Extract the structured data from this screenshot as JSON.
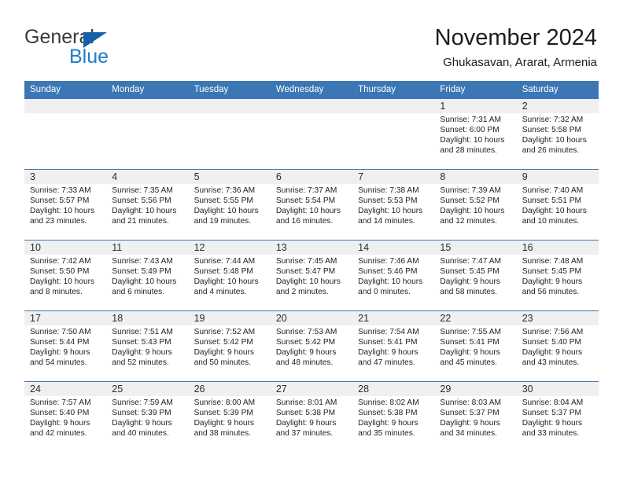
{
  "brand": {
    "name_part1": "General",
    "name_part2": "Blue",
    "triangle_icon": "triangle-icon",
    "accent_blue": "#1b7ec9",
    "logo_dark": "#3b3b3b"
  },
  "header": {
    "title": "November 2024",
    "subtitle": "Ghukasavan, Ararat, Armenia",
    "header_bg": "#3c77b5",
    "daynum_bg": "#f0f0f0"
  },
  "weekdays": [
    "Sunday",
    "Monday",
    "Tuesday",
    "Wednesday",
    "Thursday",
    "Friday",
    "Saturday"
  ],
  "weeks": [
    [
      {
        "day": "",
        "sunrise": "",
        "sunset": "",
        "daylight_line1": "",
        "daylight_line2": ""
      },
      {
        "day": "",
        "sunrise": "",
        "sunset": "",
        "daylight_line1": "",
        "daylight_line2": ""
      },
      {
        "day": "",
        "sunrise": "",
        "sunset": "",
        "daylight_line1": "",
        "daylight_line2": ""
      },
      {
        "day": "",
        "sunrise": "",
        "sunset": "",
        "daylight_line1": "",
        "daylight_line2": ""
      },
      {
        "day": "",
        "sunrise": "",
        "sunset": "",
        "daylight_line1": "",
        "daylight_line2": ""
      },
      {
        "day": "1",
        "sunrise": "Sunrise: 7:31 AM",
        "sunset": "Sunset: 6:00 PM",
        "daylight_line1": "Daylight: 10 hours",
        "daylight_line2": "and 28 minutes."
      },
      {
        "day": "2",
        "sunrise": "Sunrise: 7:32 AM",
        "sunset": "Sunset: 5:58 PM",
        "daylight_line1": "Daylight: 10 hours",
        "daylight_line2": "and 26 minutes."
      }
    ],
    [
      {
        "day": "3",
        "sunrise": "Sunrise: 7:33 AM",
        "sunset": "Sunset: 5:57 PM",
        "daylight_line1": "Daylight: 10 hours",
        "daylight_line2": "and 23 minutes."
      },
      {
        "day": "4",
        "sunrise": "Sunrise: 7:35 AM",
        "sunset": "Sunset: 5:56 PM",
        "daylight_line1": "Daylight: 10 hours",
        "daylight_line2": "and 21 minutes."
      },
      {
        "day": "5",
        "sunrise": "Sunrise: 7:36 AM",
        "sunset": "Sunset: 5:55 PM",
        "daylight_line1": "Daylight: 10 hours",
        "daylight_line2": "and 19 minutes."
      },
      {
        "day": "6",
        "sunrise": "Sunrise: 7:37 AM",
        "sunset": "Sunset: 5:54 PM",
        "daylight_line1": "Daylight: 10 hours",
        "daylight_line2": "and 16 minutes."
      },
      {
        "day": "7",
        "sunrise": "Sunrise: 7:38 AM",
        "sunset": "Sunset: 5:53 PM",
        "daylight_line1": "Daylight: 10 hours",
        "daylight_line2": "and 14 minutes."
      },
      {
        "day": "8",
        "sunrise": "Sunrise: 7:39 AM",
        "sunset": "Sunset: 5:52 PM",
        "daylight_line1": "Daylight: 10 hours",
        "daylight_line2": "and 12 minutes."
      },
      {
        "day": "9",
        "sunrise": "Sunrise: 7:40 AM",
        "sunset": "Sunset: 5:51 PM",
        "daylight_line1": "Daylight: 10 hours",
        "daylight_line2": "and 10 minutes."
      }
    ],
    [
      {
        "day": "10",
        "sunrise": "Sunrise: 7:42 AM",
        "sunset": "Sunset: 5:50 PM",
        "daylight_line1": "Daylight: 10 hours",
        "daylight_line2": "and 8 minutes."
      },
      {
        "day": "11",
        "sunrise": "Sunrise: 7:43 AM",
        "sunset": "Sunset: 5:49 PM",
        "daylight_line1": "Daylight: 10 hours",
        "daylight_line2": "and 6 minutes."
      },
      {
        "day": "12",
        "sunrise": "Sunrise: 7:44 AM",
        "sunset": "Sunset: 5:48 PM",
        "daylight_line1": "Daylight: 10 hours",
        "daylight_line2": "and 4 minutes."
      },
      {
        "day": "13",
        "sunrise": "Sunrise: 7:45 AM",
        "sunset": "Sunset: 5:47 PM",
        "daylight_line1": "Daylight: 10 hours",
        "daylight_line2": "and 2 minutes."
      },
      {
        "day": "14",
        "sunrise": "Sunrise: 7:46 AM",
        "sunset": "Sunset: 5:46 PM",
        "daylight_line1": "Daylight: 10 hours",
        "daylight_line2": "and 0 minutes."
      },
      {
        "day": "15",
        "sunrise": "Sunrise: 7:47 AM",
        "sunset": "Sunset: 5:45 PM",
        "daylight_line1": "Daylight: 9 hours",
        "daylight_line2": "and 58 minutes."
      },
      {
        "day": "16",
        "sunrise": "Sunrise: 7:48 AM",
        "sunset": "Sunset: 5:45 PM",
        "daylight_line1": "Daylight: 9 hours",
        "daylight_line2": "and 56 minutes."
      }
    ],
    [
      {
        "day": "17",
        "sunrise": "Sunrise: 7:50 AM",
        "sunset": "Sunset: 5:44 PM",
        "daylight_line1": "Daylight: 9 hours",
        "daylight_line2": "and 54 minutes."
      },
      {
        "day": "18",
        "sunrise": "Sunrise: 7:51 AM",
        "sunset": "Sunset: 5:43 PM",
        "daylight_line1": "Daylight: 9 hours",
        "daylight_line2": "and 52 minutes."
      },
      {
        "day": "19",
        "sunrise": "Sunrise: 7:52 AM",
        "sunset": "Sunset: 5:42 PM",
        "daylight_line1": "Daylight: 9 hours",
        "daylight_line2": "and 50 minutes."
      },
      {
        "day": "20",
        "sunrise": "Sunrise: 7:53 AM",
        "sunset": "Sunset: 5:42 PM",
        "daylight_line1": "Daylight: 9 hours",
        "daylight_line2": "and 48 minutes."
      },
      {
        "day": "21",
        "sunrise": "Sunrise: 7:54 AM",
        "sunset": "Sunset: 5:41 PM",
        "daylight_line1": "Daylight: 9 hours",
        "daylight_line2": "and 47 minutes."
      },
      {
        "day": "22",
        "sunrise": "Sunrise: 7:55 AM",
        "sunset": "Sunset: 5:41 PM",
        "daylight_line1": "Daylight: 9 hours",
        "daylight_line2": "and 45 minutes."
      },
      {
        "day": "23",
        "sunrise": "Sunrise: 7:56 AM",
        "sunset": "Sunset: 5:40 PM",
        "daylight_line1": "Daylight: 9 hours",
        "daylight_line2": "and 43 minutes."
      }
    ],
    [
      {
        "day": "24",
        "sunrise": "Sunrise: 7:57 AM",
        "sunset": "Sunset: 5:40 PM",
        "daylight_line1": "Daylight: 9 hours",
        "daylight_line2": "and 42 minutes."
      },
      {
        "day": "25",
        "sunrise": "Sunrise: 7:59 AM",
        "sunset": "Sunset: 5:39 PM",
        "daylight_line1": "Daylight: 9 hours",
        "daylight_line2": "and 40 minutes."
      },
      {
        "day": "26",
        "sunrise": "Sunrise: 8:00 AM",
        "sunset": "Sunset: 5:39 PM",
        "daylight_line1": "Daylight: 9 hours",
        "daylight_line2": "and 38 minutes."
      },
      {
        "day": "27",
        "sunrise": "Sunrise: 8:01 AM",
        "sunset": "Sunset: 5:38 PM",
        "daylight_line1": "Daylight: 9 hours",
        "daylight_line2": "and 37 minutes."
      },
      {
        "day": "28",
        "sunrise": "Sunrise: 8:02 AM",
        "sunset": "Sunset: 5:38 PM",
        "daylight_line1": "Daylight: 9 hours",
        "daylight_line2": "and 35 minutes."
      },
      {
        "day": "29",
        "sunrise": "Sunrise: 8:03 AM",
        "sunset": "Sunset: 5:37 PM",
        "daylight_line1": "Daylight: 9 hours",
        "daylight_line2": "and 34 minutes."
      },
      {
        "day": "30",
        "sunrise": "Sunrise: 8:04 AM",
        "sunset": "Sunset: 5:37 PM",
        "daylight_line1": "Daylight: 9 hours",
        "daylight_line2": "and 33 minutes."
      }
    ]
  ]
}
